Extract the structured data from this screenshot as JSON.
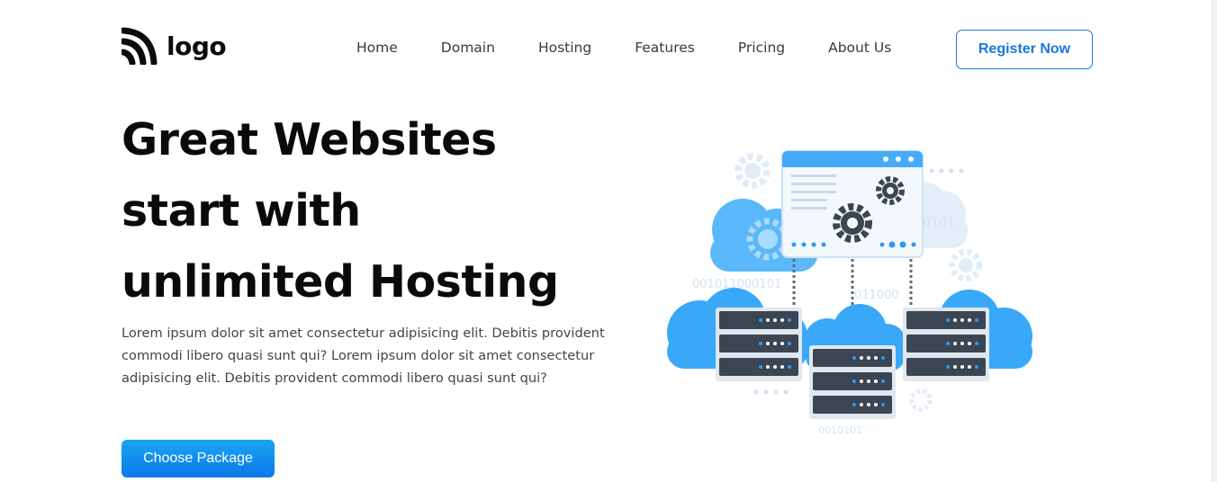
{
  "brand": {
    "logo_text": "logo",
    "logo_icon": "rss-feed-icon"
  },
  "nav": {
    "items": [
      {
        "label": "Home"
      },
      {
        "label": "Domain"
      },
      {
        "label": "Hosting"
      },
      {
        "label": "Features"
      },
      {
        "label": "Pricing"
      },
      {
        "label": "About Us"
      }
    ],
    "cta_label": "Register Now"
  },
  "hero": {
    "title_lines": [
      "Great Websites",
      "start with",
      "unlimited Hosting"
    ],
    "description": "Lorem ipsum dolor sit amet consectetur adipisicing elit. Debitis provident commodi libero quasi sunt qui? Lorem ipsum dolor sit amet consectetur adipisicing elit. Debitis provident commodi libero quasi sunt qui?",
    "button_label": "Choose Package"
  },
  "illustration": {
    "binary_texts": [
      "0101",
      "001011000101",
      "011000",
      "0010101"
    ],
    "icons": [
      "cloud-icon",
      "gear-icon",
      "server-rack-icon",
      "browser-window-icon"
    ]
  },
  "colors": {
    "accent": "#1a78e0",
    "button_gradient_top": "#1aa4f5",
    "button_gradient_bottom": "#0a78e8",
    "cloud_blue": "#3aa8f8",
    "cloud_light": "#dbeaf8",
    "server_dark": "#3c4552"
  }
}
